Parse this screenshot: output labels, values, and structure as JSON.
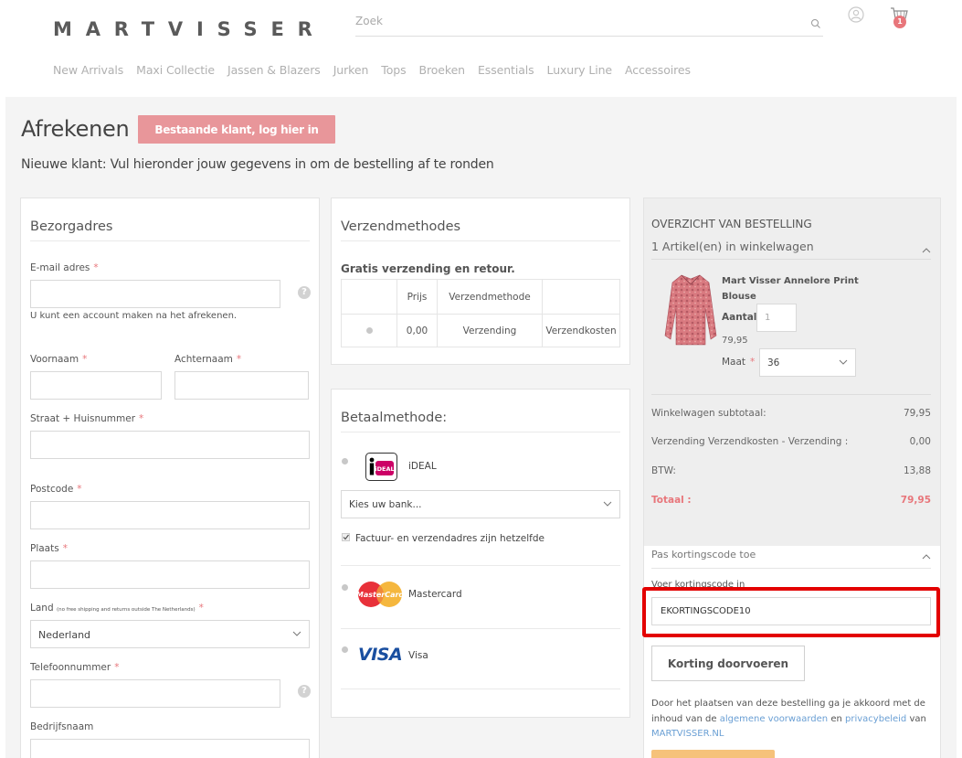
{
  "header": {
    "logo": "MARTVISSER",
    "search_placeholder": "Zoek",
    "cart_count": "1"
  },
  "nav": [
    "New Arrivals",
    "Maxi Collectie",
    "Jassen & Blazers",
    "Jurken",
    "Tops",
    "Broeken",
    "Essentials",
    "Luxury Line",
    "Accessoires"
  ],
  "page": {
    "title": "Afrekenen",
    "login_button": "Bestaande klant, log hier in",
    "subtitle": "Nieuwe klant: Vul hieronder jouw gegevens in om de bestelling af te ronden"
  },
  "address": {
    "heading": "Bezorgadres",
    "email_label": "E-mail adres",
    "email_note": "U kunt een account maken na het afrekenen.",
    "firstname_label": "Voornaam",
    "lastname_label": "Achternaam",
    "street_label": "Straat + Huisnummer",
    "postcode_label": "Postcode",
    "city_label": "Plaats",
    "country_label": "Land",
    "country_note": "(no free shipping and returns outside The Netherlands)",
    "country_value": "Nederland",
    "phone_label": "Telefoonnummer",
    "company_label": "Bedrijfsnaam",
    "required_mark": "*",
    "help_mark": "?"
  },
  "shipping": {
    "heading": "Verzendmethodes",
    "free_text": "Gratis verzending en retour.",
    "col_price": "Prijs",
    "col_method": "Verzendmethode",
    "row_price": "0,00",
    "row_method": "Verzending",
    "row_carrier": "Verzendkosten"
  },
  "payment": {
    "heading": "Betaalmethode:",
    "ideal_label": "iDEAL",
    "ideal_logo_text": "iDEAL",
    "bank_placeholder": "Kies uw bank...",
    "same_address": "Factuur- en verzendadres zijn hetzelfde",
    "mastercard_label": "Mastercard",
    "mastercard_logo_text": "MasterCard",
    "visa_label": "Visa",
    "visa_logo_text": "VISA"
  },
  "summary": {
    "heading": "OVERZICHT VAN BESTELLING",
    "items_count": "1 Artikel(en) in winkelwagen",
    "product_name": "Mart Visser Annelore Print Blouse",
    "qty_label": "Aantal",
    "qty_value": "1",
    "price": "79,95",
    "size_label": "Maat",
    "size_value": "36",
    "subtotal_label": "Winkelwagen subtotaal:",
    "subtotal_value": "79,95",
    "shipping_label": "Verzending Verzendkosten - Verzending :",
    "shipping_value": "0,00",
    "tax_label": "BTW:",
    "tax_value": "13,88",
    "total_label": "Totaal :",
    "total_value": "79,95",
    "discount_heading": "Pas kortingscode toe",
    "discount_label": "Voer kortingscode in",
    "discount_value": "EKORTINGSCODE10",
    "discount_button": "Korting doorvoeren",
    "terms_1": "Door het plaatsen van deze bestelling ga je akkoord met de inhoud van de",
    "terms_link1": "algemene voorwaarden",
    "terms_2": "en",
    "terms_link2": "privacybeleid",
    "terms_3": "van",
    "terms_link3": "MARTVISSER.NL"
  },
  "colors": {
    "accent": "#e8767b",
    "button_pink": "#e8969a",
    "link": "#6a9fd4",
    "highlight": "#e30000",
    "order_button": "#f6c27a"
  }
}
